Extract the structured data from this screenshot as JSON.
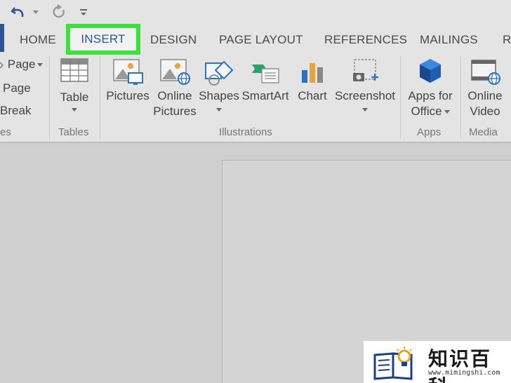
{
  "quick_access": {
    "undo": "undo-icon",
    "redo": "redo-icon",
    "customize": "customize-qat-icon"
  },
  "tabs": {
    "home": "HOME",
    "insert": "INSERT",
    "design": "DESIGN",
    "page_layout": "PAGE LAYOUT",
    "references": "REFERENCES",
    "mailings": "MAILINGS",
    "more": "R"
  },
  "active_tab": "INSERT",
  "highlight_color": "#3ee03e",
  "ribbon": {
    "pages_group": {
      "items": [
        "Page",
        "Page",
        "Break"
      ],
      "label": "es"
    },
    "tables_group": {
      "table_label": "Table",
      "label": "Tables"
    },
    "illustrations_group": {
      "pictures": "Pictures",
      "online_pictures_1": "Online",
      "online_pictures_2": "Pictures",
      "shapes": "Shapes",
      "smartart": "SmartArt",
      "chart": "Chart",
      "screenshot": "Screenshot",
      "label": "Illustrations"
    },
    "apps_group": {
      "apps_1": "Apps for",
      "apps_2": "Office",
      "label": "Apps"
    },
    "media_group": {
      "video_1": "Online",
      "video_2": "Video",
      "label": "Media"
    }
  },
  "watermark": {
    "title": "知识百科",
    "url": "www.mimingshi.com"
  }
}
